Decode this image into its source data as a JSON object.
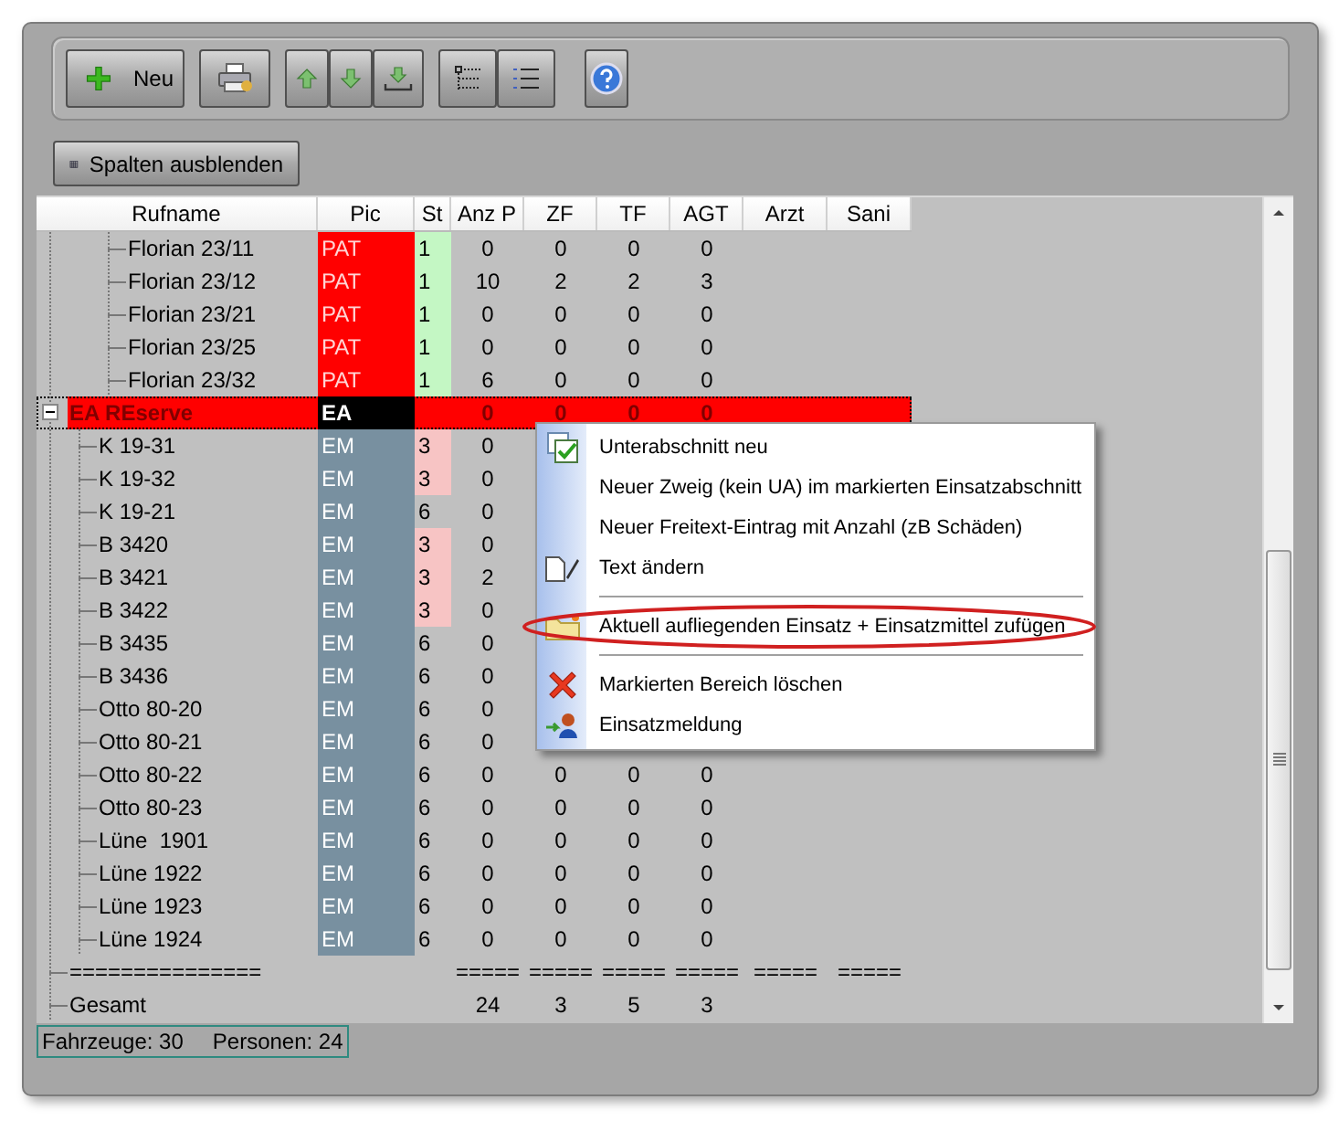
{
  "toolbar": {
    "groups": [
      [
        {
          "kind": "add",
          "label": "Neu"
        }
      ],
      [
        {
          "kind": "print"
        }
      ],
      [
        {
          "kind": "up"
        },
        {
          "kind": "down"
        },
        {
          "kind": "import"
        }
      ],
      [
        {
          "kind": "tree"
        },
        {
          "kind": "list"
        }
      ],
      [
        {
          "kind": "help"
        }
      ]
    ]
  },
  "column_button": {
    "label": "Spalten ausblenden"
  },
  "table": {
    "columns": [
      "Rufname",
      "Pic",
      "St",
      "Anz P",
      "ZF",
      "TF",
      "AGT",
      "Arzt",
      "Sani"
    ],
    "continued_rows": [
      {
        "kind": "vehicle",
        "name": "Florian 23/11",
        "pic": {
          "text": "PAT",
          "color": "#ff0000"
        },
        "st": {
          "text": "1",
          "color": "#c4f7c4"
        },
        "values": [
          "0",
          "0",
          "0",
          "0"
        ]
      },
      {
        "kind": "vehicle",
        "name": "Florian 23/12",
        "pic": {
          "text": "PAT",
          "color": "#ff0000"
        },
        "st": {
          "text": "1",
          "color": "#c4f7c4"
        },
        "values": [
          "10",
          "2",
          "2",
          "3"
        ]
      },
      {
        "kind": "vehicle",
        "name": "Florian 23/21",
        "pic": {
          "text": "PAT",
          "color": "#ff0000"
        },
        "st": {
          "text": "1",
          "color": "#c4f7c4"
        },
        "values": [
          "0",
          "0",
          "0",
          "0"
        ]
      },
      {
        "kind": "vehicle",
        "name": "Florian 23/25",
        "pic": {
          "text": "PAT",
          "color": "#ff0000"
        },
        "st": {
          "text": "1",
          "color": "#c4f7c4"
        },
        "values": [
          "0",
          "0",
          "0",
          "0"
        ]
      },
      {
        "kind": "vehicle",
        "name": "Florian 23/32",
        "pic": {
          "text": "PAT",
          "color": "#ff0000"
        },
        "st": {
          "text": "1",
          "color": "#c4f7c4"
        },
        "values": [
          "6",
          "0",
          "0",
          "0"
        ]
      }
    ],
    "rows": [
      {
        "kind": "group",
        "name": "EA REserve",
        "color": "#ff0000",
        "selected": true,
        "expanded": true,
        "pic": {
          "text": "EA",
          "color": "#000000"
        },
        "values": [
          "0",
          "0",
          "0",
          "0"
        ],
        "children": [
          {
            "kind": "vehicle",
            "name": "K 19-31",
            "pic": {
              "text": "EM",
              "color": "#7890a0"
            },
            "st": {
              "text": "3",
              "color": "#f7c4c4"
            },
            "values": [
              "0"
            ]
          },
          {
            "kind": "vehicle",
            "name": "K 19-32",
            "pic": {
              "text": "EM",
              "color": "#7890a0"
            },
            "st": {
              "text": "3",
              "color": "#f7c4c4"
            },
            "values": [
              "0"
            ]
          },
          {
            "kind": "vehicle",
            "name": "K 19-21",
            "pic": {
              "text": "EM",
              "color": "#7890a0"
            },
            "st": {
              "text": "6"
            },
            "values": [
              "0"
            ]
          },
          {
            "kind": "vehicle",
            "name": "B 3420",
            "pic": {
              "text": "EM",
              "color": "#7890a0"
            },
            "st": {
              "text": "3",
              "color": "#f7c4c4"
            },
            "values": [
              "0"
            ]
          },
          {
            "kind": "vehicle",
            "name": "B 3421",
            "pic": {
              "text": "EM",
              "color": "#7890a0"
            },
            "st": {
              "text": "3",
              "color": "#f7c4c4"
            },
            "values": [
              "2"
            ]
          },
          {
            "kind": "vehicle",
            "name": "B 3422",
            "pic": {
              "text": "EM",
              "color": "#7890a0"
            },
            "st": {
              "text": "3",
              "color": "#f7c4c4"
            },
            "values": [
              "0"
            ]
          },
          {
            "kind": "vehicle",
            "name": "B 3435",
            "pic": {
              "text": "EM",
              "color": "#7890a0"
            },
            "st": {
              "text": "6"
            },
            "values": [
              "0"
            ]
          },
          {
            "kind": "vehicle",
            "name": "B 3436",
            "pic": {
              "text": "EM",
              "color": "#7890a0"
            },
            "st": {
              "text": "6"
            },
            "values": [
              "0"
            ]
          },
          {
            "kind": "vehicle",
            "name": "Otto 80-20",
            "pic": {
              "text": "EM",
              "color": "#7890a0"
            },
            "st": {
              "text": "6"
            },
            "values": [
              "0"
            ]
          },
          {
            "kind": "vehicle",
            "name": "Otto 80-21",
            "pic": {
              "text": "EM",
              "color": "#7890a0"
            },
            "st": {
              "text": "6"
            },
            "values": [
              "0"
            ]
          },
          {
            "kind": "vehicle",
            "name": "Otto 80-22",
            "pic": {
              "text": "EM",
              "color": "#7890a0"
            },
            "st": {
              "text": "6"
            },
            "values": [
              "0",
              "0",
              "0",
              "0"
            ]
          },
          {
            "kind": "vehicle",
            "name": "Otto 80-23",
            "pic": {
              "text": "EM",
              "color": "#7890a0"
            },
            "st": {
              "text": "6"
            },
            "values": [
              "0",
              "0",
              "0",
              "0"
            ]
          },
          {
            "kind": "vehicle",
            "name": "Lüne  1901",
            "pic": {
              "text": "EM",
              "color": "#7890a0"
            },
            "st": {
              "text": "6"
            },
            "values": [
              "0",
              "0",
              "0",
              "0"
            ]
          },
          {
            "kind": "vehicle",
            "name": "Lüne 1922",
            "pic": {
              "text": "EM",
              "color": "#7890a0"
            },
            "st": {
              "text": "6"
            },
            "values": [
              "0",
              "0",
              "0",
              "0"
            ]
          },
          {
            "kind": "vehicle",
            "name": "Lüne 1923",
            "pic": {
              "text": "EM",
              "color": "#7890a0"
            },
            "st": {
              "text": "6"
            },
            "values": [
              "0",
              "0",
              "0",
              "0"
            ]
          },
          {
            "kind": "vehicle",
            "name": "Lüne 1924",
            "pic": {
              "text": "EM",
              "color": "#7890a0"
            },
            "st": {
              "text": "6"
            },
            "values": [
              "0",
              "0",
              "0",
              "0"
            ]
          }
        ]
      },
      {
        "kind": "separator",
        "name": "===============",
        "values": [
          "=====",
          "=====",
          "=====",
          "=====",
          "=====",
          "====="
        ]
      },
      {
        "kind": "total",
        "name": "Gesamt",
        "values": [
          "24",
          "3",
          "5",
          "3"
        ]
      }
    ]
  },
  "status_bar": [
    "Fahrzeuge: 30",
    "Personen: 24"
  ],
  "context_menu": {
    "items": [
      {
        "kind": "item",
        "label": "Unterabschnitt neu",
        "circled": false
      },
      {
        "kind": "item",
        "label": "Neuer Zweig (kein UA) im markierten Einsatzabschnitt",
        "circled": false
      },
      {
        "kind": "item",
        "label": "Neuer Freitext-Eintrag mit Anzahl (zB Schäden)",
        "circled": false
      },
      {
        "kind": "item",
        "label": "Text ändern",
        "circled": false
      },
      {
        "kind": "separator"
      },
      {
        "kind": "item",
        "label": "Aktuell aufliegenden Einsatz + Einsatzmittel zufügen",
        "circled": true
      },
      {
        "kind": "separator"
      },
      {
        "kind": "item",
        "label": "Markierten Bereich löschen",
        "circled": false
      },
      {
        "kind": "item",
        "label": "Einsatzmeldung",
        "circled": false
      }
    ]
  }
}
